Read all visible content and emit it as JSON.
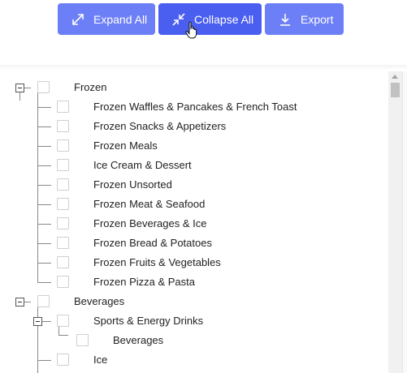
{
  "toolbar": {
    "expand_all_label": "Expand All",
    "collapse_all_label": "Collapse All",
    "export_label": "Export",
    "button_color": "#6d7ff6"
  },
  "tree": {
    "frozen": {
      "label": "Frozen",
      "children": [
        "Frozen Waffles & Pancakes & French Toast",
        "Frozen Snacks & Appetizers",
        "Frozen Meals",
        "Ice Cream & Dessert",
        "Frozen Unsorted",
        "Frozen Meat & Seafood",
        "Frozen Beverages & Ice",
        "Frozen Bread & Potatoes",
        "Frozen Fruits & Vegetables",
        "Frozen Pizza & Pasta"
      ]
    },
    "beverages": {
      "label": "Beverages",
      "sports": {
        "label": "Sports & Energy Drinks",
        "children": [
          "Beverages"
        ]
      },
      "ice": {
        "label": "Ice"
      }
    }
  }
}
